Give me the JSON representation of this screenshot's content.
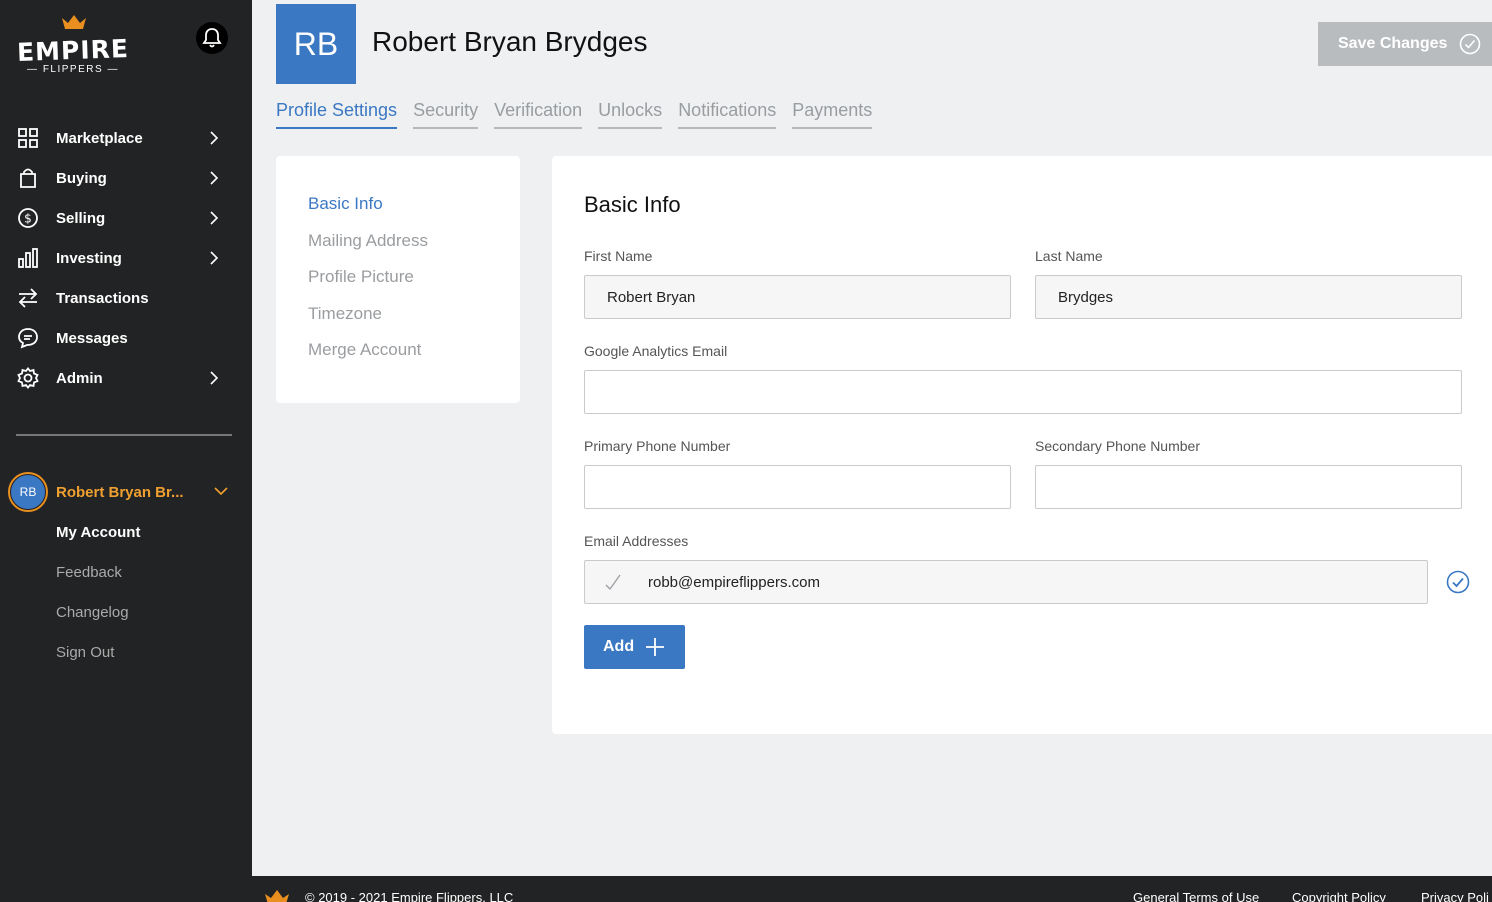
{
  "brand": {
    "name": "EMPIRE",
    "subtitle": "FLIPPERS",
    "accent": "#e98f1f",
    "primary": "#3b78c3"
  },
  "sidebar": {
    "items": [
      {
        "label": "Marketplace",
        "icon": "grid-icon",
        "has_chevron": true
      },
      {
        "label": "Buying",
        "icon": "shopping-bag-icon",
        "has_chevron": true
      },
      {
        "label": "Selling",
        "icon": "dollar-circle-icon",
        "has_chevron": true
      },
      {
        "label": "Investing",
        "icon": "bar-chart-icon",
        "has_chevron": true
      },
      {
        "label": "Transactions",
        "icon": "transfer-arrows-icon",
        "has_chevron": false
      },
      {
        "label": "Messages",
        "icon": "message-bubble-icon",
        "has_chevron": false
      },
      {
        "label": "Admin",
        "icon": "gear-icon",
        "has_chevron": true
      }
    ],
    "user": {
      "initials": "RB",
      "name": "Robert Bryan Br..."
    },
    "user_menu": [
      "My Account",
      "Feedback",
      "Changelog",
      "Sign Out"
    ]
  },
  "header": {
    "initials": "RB",
    "title": "Robert Bryan Brydges",
    "save_label": "Save Changes"
  },
  "tabs": [
    "Profile Settings",
    "Security",
    "Verification",
    "Unlocks",
    "Notifications",
    "Payments"
  ],
  "side_nav": [
    "Basic Info",
    "Mailing Address",
    "Profile Picture",
    "Timezone",
    "Merge Account"
  ],
  "form": {
    "title": "Basic Info",
    "first_name": {
      "label": "First Name",
      "value": "Robert Bryan"
    },
    "last_name": {
      "label": "Last Name",
      "value": "Brydges"
    },
    "ga_email": {
      "label": "Google Analytics Email",
      "value": ""
    },
    "primary_phone": {
      "label": "Primary Phone Number",
      "value": ""
    },
    "secondary_phone": {
      "label": "Secondary Phone Number",
      "value": ""
    },
    "emails": {
      "label": "Email Addresses",
      "values": [
        "robb@empireflippers.com"
      ]
    },
    "add_label": "Add"
  },
  "footer": {
    "copyright": "© 2019 - 2021 Empire Flippers, LLC",
    "links": [
      "General Terms of Use",
      "Copyright Policy",
      "Privacy Poli"
    ]
  }
}
